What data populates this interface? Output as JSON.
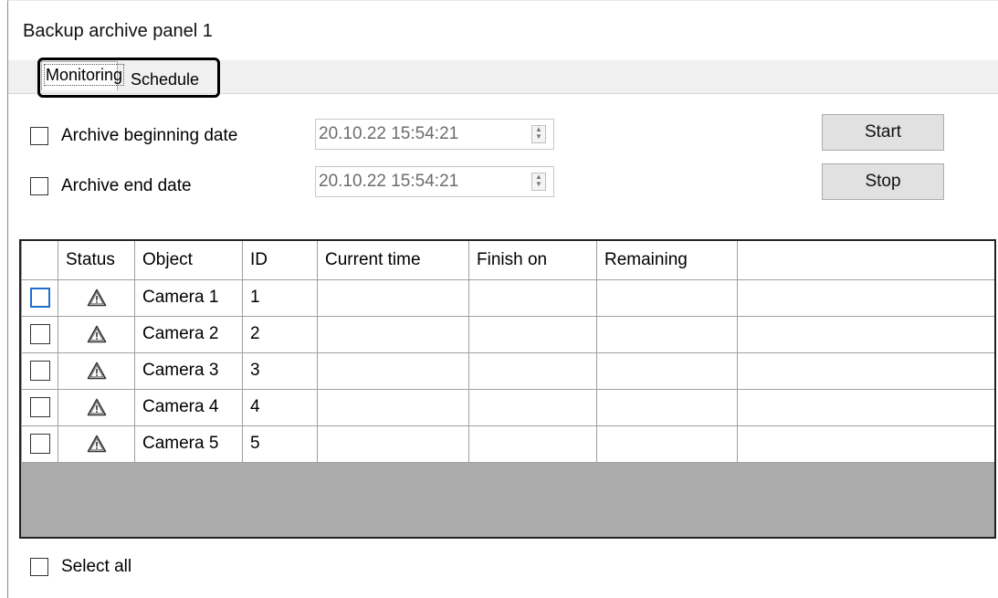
{
  "window": {
    "title": "Backup archive panel 1"
  },
  "tabs": [
    {
      "label": "Monitoring",
      "active": true
    },
    {
      "label": "Schedule",
      "active": false
    }
  ],
  "filters": {
    "beginning": {
      "label": "Archive beginning date",
      "checked": false,
      "value": "20.10.22 15:54:21"
    },
    "end": {
      "label": "Archive end date",
      "checked": false,
      "value": "20.10.22 15:54:21"
    }
  },
  "buttons": {
    "start": "Start",
    "stop": "Stop"
  },
  "table": {
    "columns": [
      "Status",
      "Object",
      "ID",
      "Current time",
      "Finish on",
      "Remaining"
    ],
    "rows": [
      {
        "status": "warning",
        "object": "Camera 1",
        "id": "1",
        "current_time": "",
        "finish_on": "",
        "remaining": ""
      },
      {
        "status": "warning",
        "object": "Camera 2",
        "id": "2",
        "current_time": "",
        "finish_on": "",
        "remaining": ""
      },
      {
        "status": "warning",
        "object": "Camera 3",
        "id": "3",
        "current_time": "",
        "finish_on": "",
        "remaining": ""
      },
      {
        "status": "warning",
        "object": "Camera 4",
        "id": "4",
        "current_time": "",
        "finish_on": "",
        "remaining": ""
      },
      {
        "status": "warning",
        "object": "Camera 5",
        "id": "5",
        "current_time": "",
        "finish_on": "",
        "remaining": ""
      }
    ]
  },
  "select_all": {
    "label": "Select all",
    "checked": false
  },
  "icons": {
    "status": "warning-triangle-icon",
    "spinner": "up-down-spinner-icon"
  },
  "colors": {
    "tabstrip": "#f0f0f0",
    "grid_empty": "#ababab",
    "focus": "#1e6fd0"
  }
}
